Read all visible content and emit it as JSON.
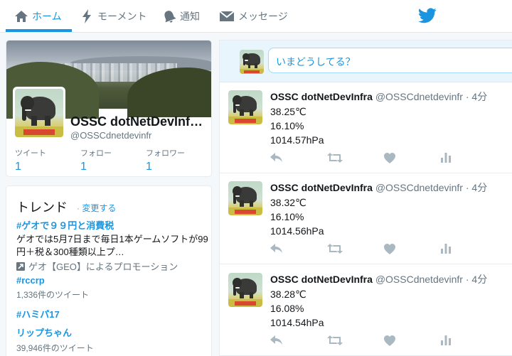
{
  "nav": {
    "items": [
      {
        "label": "ホーム",
        "icon": "home-icon",
        "active": true
      },
      {
        "label": "モーメント",
        "icon": "lightning-icon",
        "active": false
      },
      {
        "label": "通知",
        "icon": "bell-icon",
        "active": false
      },
      {
        "label": "メッセージ",
        "icon": "envelope-icon",
        "active": false
      }
    ],
    "brand_icon": "twitter-bird-icon"
  },
  "profile": {
    "name": "OSSC dotNetDevInf…",
    "handle": "@OSSCdnetdevinfr",
    "stats": [
      {
        "label": "ツイート",
        "value": "1"
      },
      {
        "label": "フォロー",
        "value": "1"
      },
      {
        "label": "フォロワー",
        "value": "1"
      }
    ]
  },
  "trends": {
    "title": "トレンド",
    "change_label": "変更する",
    "items": [
      {
        "title": "#ゲオで９９円と消費税",
        "desc": "ゲオでは5月7日まで毎日1本ゲームソフトが99円＋税＆300種類以上プ…",
        "promo": "ゲオ【GEO】によるプロモーション"
      },
      {
        "title": "#rccrp",
        "count": "1,336件のツイート"
      },
      {
        "title": "#ハミパ17"
      },
      {
        "title": "リップちゃん",
        "count": "39,946件のツイート"
      }
    ]
  },
  "compose": {
    "placeholder": "いまどうしてる？"
  },
  "tweets": [
    {
      "name": "OSSC dotNetDevInfra",
      "handle": "@OSSCdnetdevinfr",
      "time": "· 4分",
      "lines": [
        "38.25℃",
        "16.10%",
        "1014.57hPa"
      ]
    },
    {
      "name": "OSSC dotNetDevInfra",
      "handle": "@OSSCdnetdevinfr",
      "time": "· 4分",
      "lines": [
        "38.32℃",
        "16.10%",
        "1014.56hPa"
      ]
    },
    {
      "name": "OSSC dotNetDevInfra",
      "handle": "@OSSCdnetdevinfr",
      "time": "· 4分",
      "lines": [
        "38.28℃",
        "16.08%",
        "1014.54hPa"
      ]
    }
  ],
  "colors": {
    "accent": "#1b95e0",
    "background": "#f5f8fa",
    "muted": "#66757f",
    "action": "#aab8c2"
  }
}
